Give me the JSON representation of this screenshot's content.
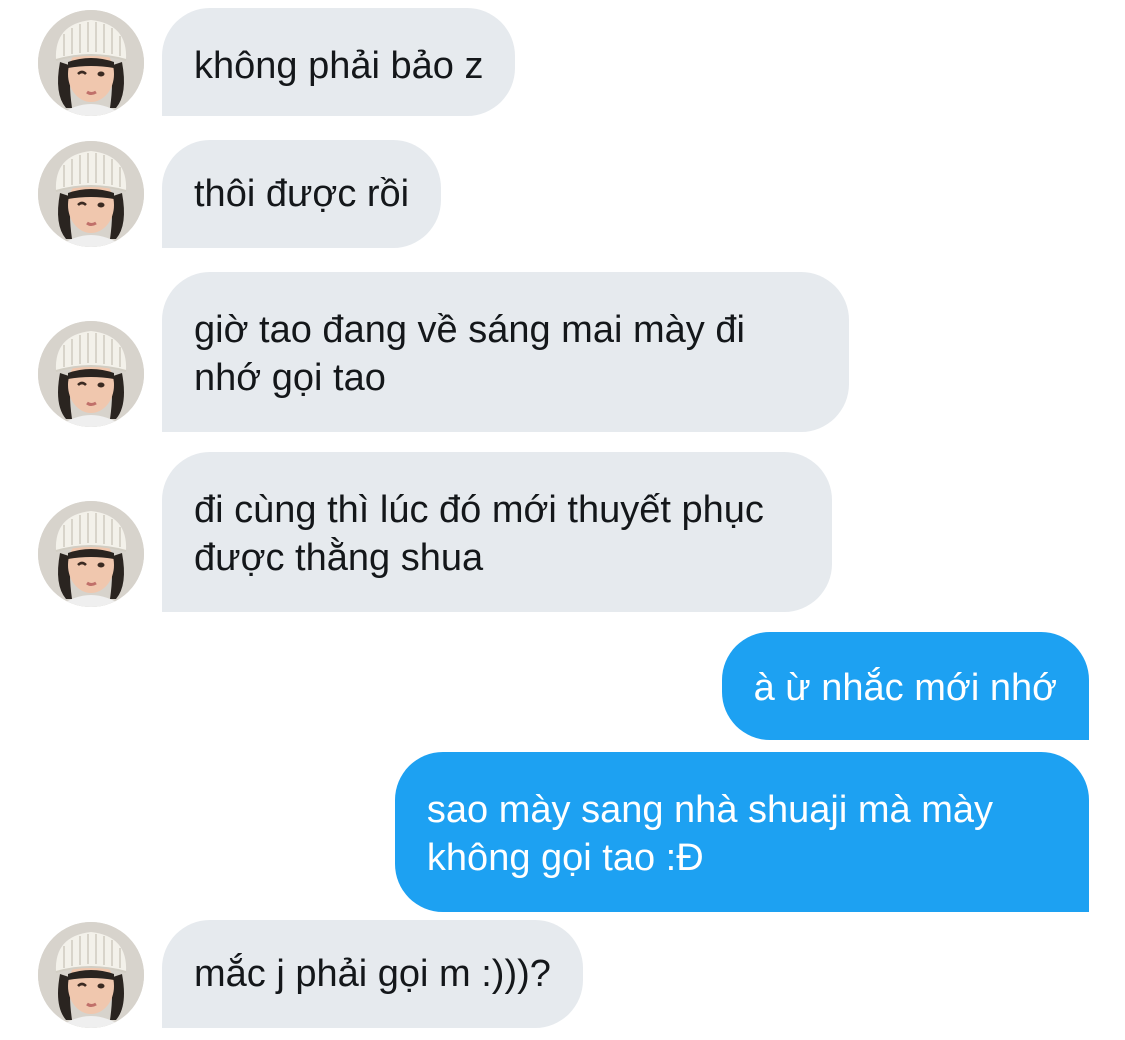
{
  "conversation": {
    "messages": [
      {
        "sender": "them",
        "lines": [
          "không phải bảo z"
        ]
      },
      {
        "sender": "them",
        "lines": [
          "thôi được rồi"
        ]
      },
      {
        "sender": "them",
        "lines": [
          "giờ tao đang về sáng mai mày đi",
          "nhớ gọi tao"
        ]
      },
      {
        "sender": "them",
        "lines": [
          "đi cùng thì lúc đó mới thuyết phục",
          "được thằng shua"
        ]
      },
      {
        "sender": "me",
        "lines": [
          "à ừ nhắc mới nhớ"
        ]
      },
      {
        "sender": "me",
        "lines": [
          "sao mày sang nhà shuaji mà mày",
          "không gọi tao :Đ"
        ]
      },
      {
        "sender": "them",
        "lines": [
          "mắc j phải gọi m :)))?"
        ]
      }
    ]
  },
  "colors": {
    "received_bubble": "#e6eaee",
    "received_text": "#14171a",
    "sent_bubble": "#1da1f2",
    "sent_text": "#ffffff"
  },
  "icons": {
    "contact_avatar": "avatar-photo-person-white-beanie"
  }
}
